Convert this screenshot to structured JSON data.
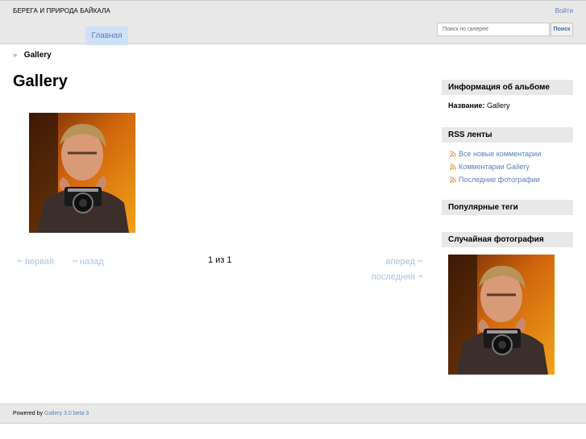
{
  "header": {
    "site_title": "БЕРЕГА И ПРИРОДА БАЙКАЛА",
    "login_label": "Войти",
    "nav_home": "Главная",
    "search_placeholder": "Поиск по галерее",
    "search_button": "Поиск"
  },
  "breadcrumb": {
    "separator": "»",
    "current": "Gallery"
  },
  "main": {
    "title": "Gallery",
    "pager": {
      "first": "первая",
      "prev": "назад",
      "info": "1 из 1",
      "next": "вперед",
      "last": "последняя"
    }
  },
  "sidebar": {
    "album_info_heading": "Информация об альбоме",
    "album_name_label": "Название:",
    "album_name_value": "Gallery",
    "rss_heading": "RSS ленты",
    "rss_items": [
      "Все новые комментарии",
      "Комментарии Gallery",
      "Последние фотографии"
    ],
    "tags_heading": "Популярные теги",
    "random_heading": "Случайная фотография"
  },
  "footer": {
    "powered_by": "Powered by",
    "link": "Gallery 3.0 beta 3"
  },
  "colors": {
    "link": "#5b7fb5",
    "disabled_link": "#a9c2e3",
    "panel_bg": "#e8e8e8",
    "active_tab_bg": "#cfe0f7"
  }
}
